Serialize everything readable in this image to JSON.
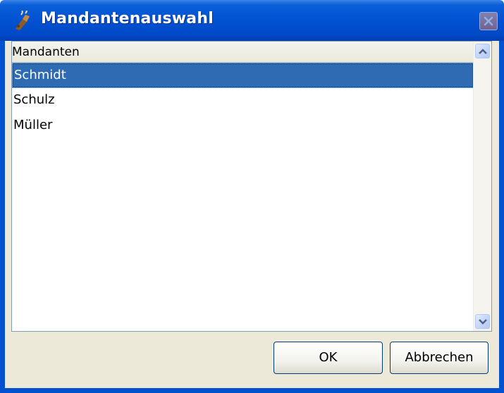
{
  "window": {
    "title": "Mandantenauswahl",
    "app_icon": "java-cup-icon",
    "close_icon": "close-icon",
    "title_bar_color": "#0451d0"
  },
  "table": {
    "column_header": "Mandanten",
    "rows": [
      "Schmidt",
      "Schulz",
      "Müller"
    ],
    "selected_row": "Schmidt",
    "selection_color": "#2e6bb3"
  },
  "scrollbar": {
    "up_icon": "chevron-up-icon",
    "down_icon": "chevron-down-icon"
  },
  "buttons": {
    "ok_label": "OK",
    "cancel_label": "Abbrechen"
  }
}
